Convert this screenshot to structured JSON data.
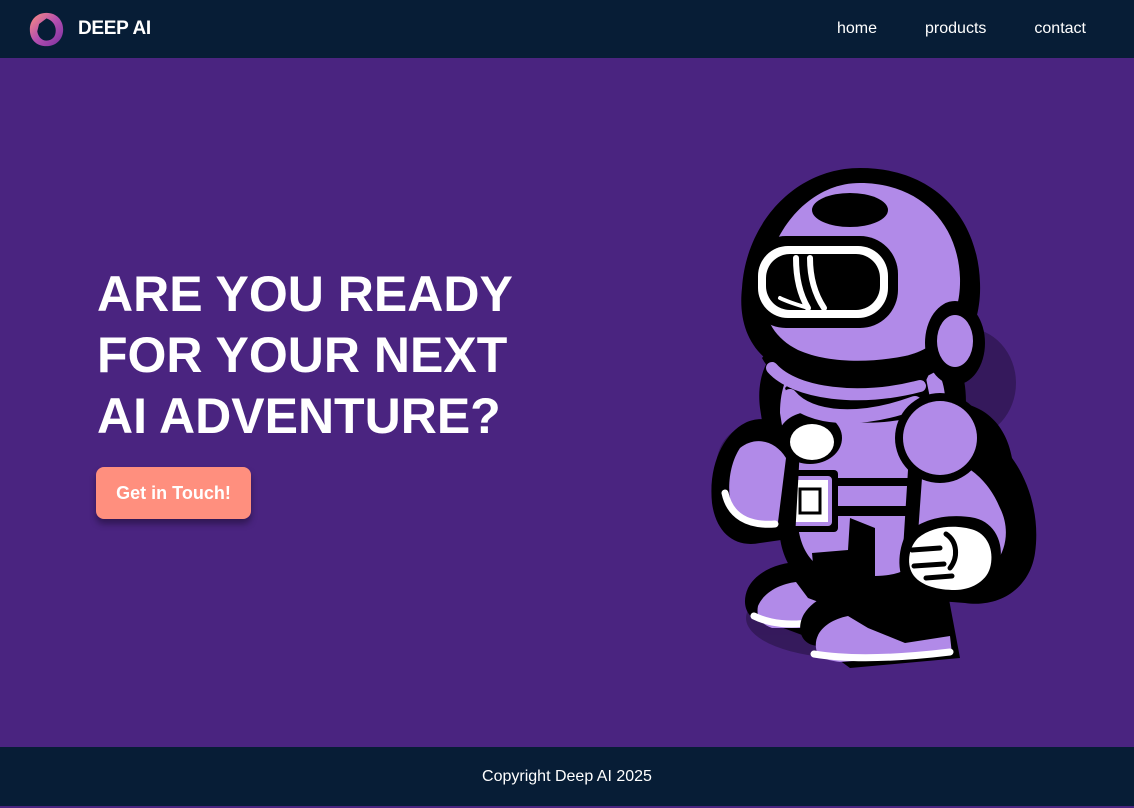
{
  "brand": {
    "name": "DEEP AI",
    "logo_icon": "ring-logo-icon",
    "logo_colors": [
      "#ff8f7e",
      "#b44fb0",
      "#7a2fa0"
    ]
  },
  "nav": {
    "items": [
      {
        "label": "home"
      },
      {
        "label": "products"
      },
      {
        "label": "contact"
      }
    ]
  },
  "hero": {
    "headline_lines": [
      "ARE YOU READY",
      "FOR YOUR NEXT",
      "AI ADVENTURE?"
    ],
    "cta_label": "Get in Touch!",
    "illustration": "astronaut-robot-mascot"
  },
  "footer": {
    "copyright": "Copyright Deep AI 2025"
  },
  "colors": {
    "header_bg": "#071d36",
    "hero_bg": "#4a2480",
    "cta_bg": "#ff8f7e",
    "mascot_purple": "#b18ae8",
    "text": "#ffffff"
  }
}
